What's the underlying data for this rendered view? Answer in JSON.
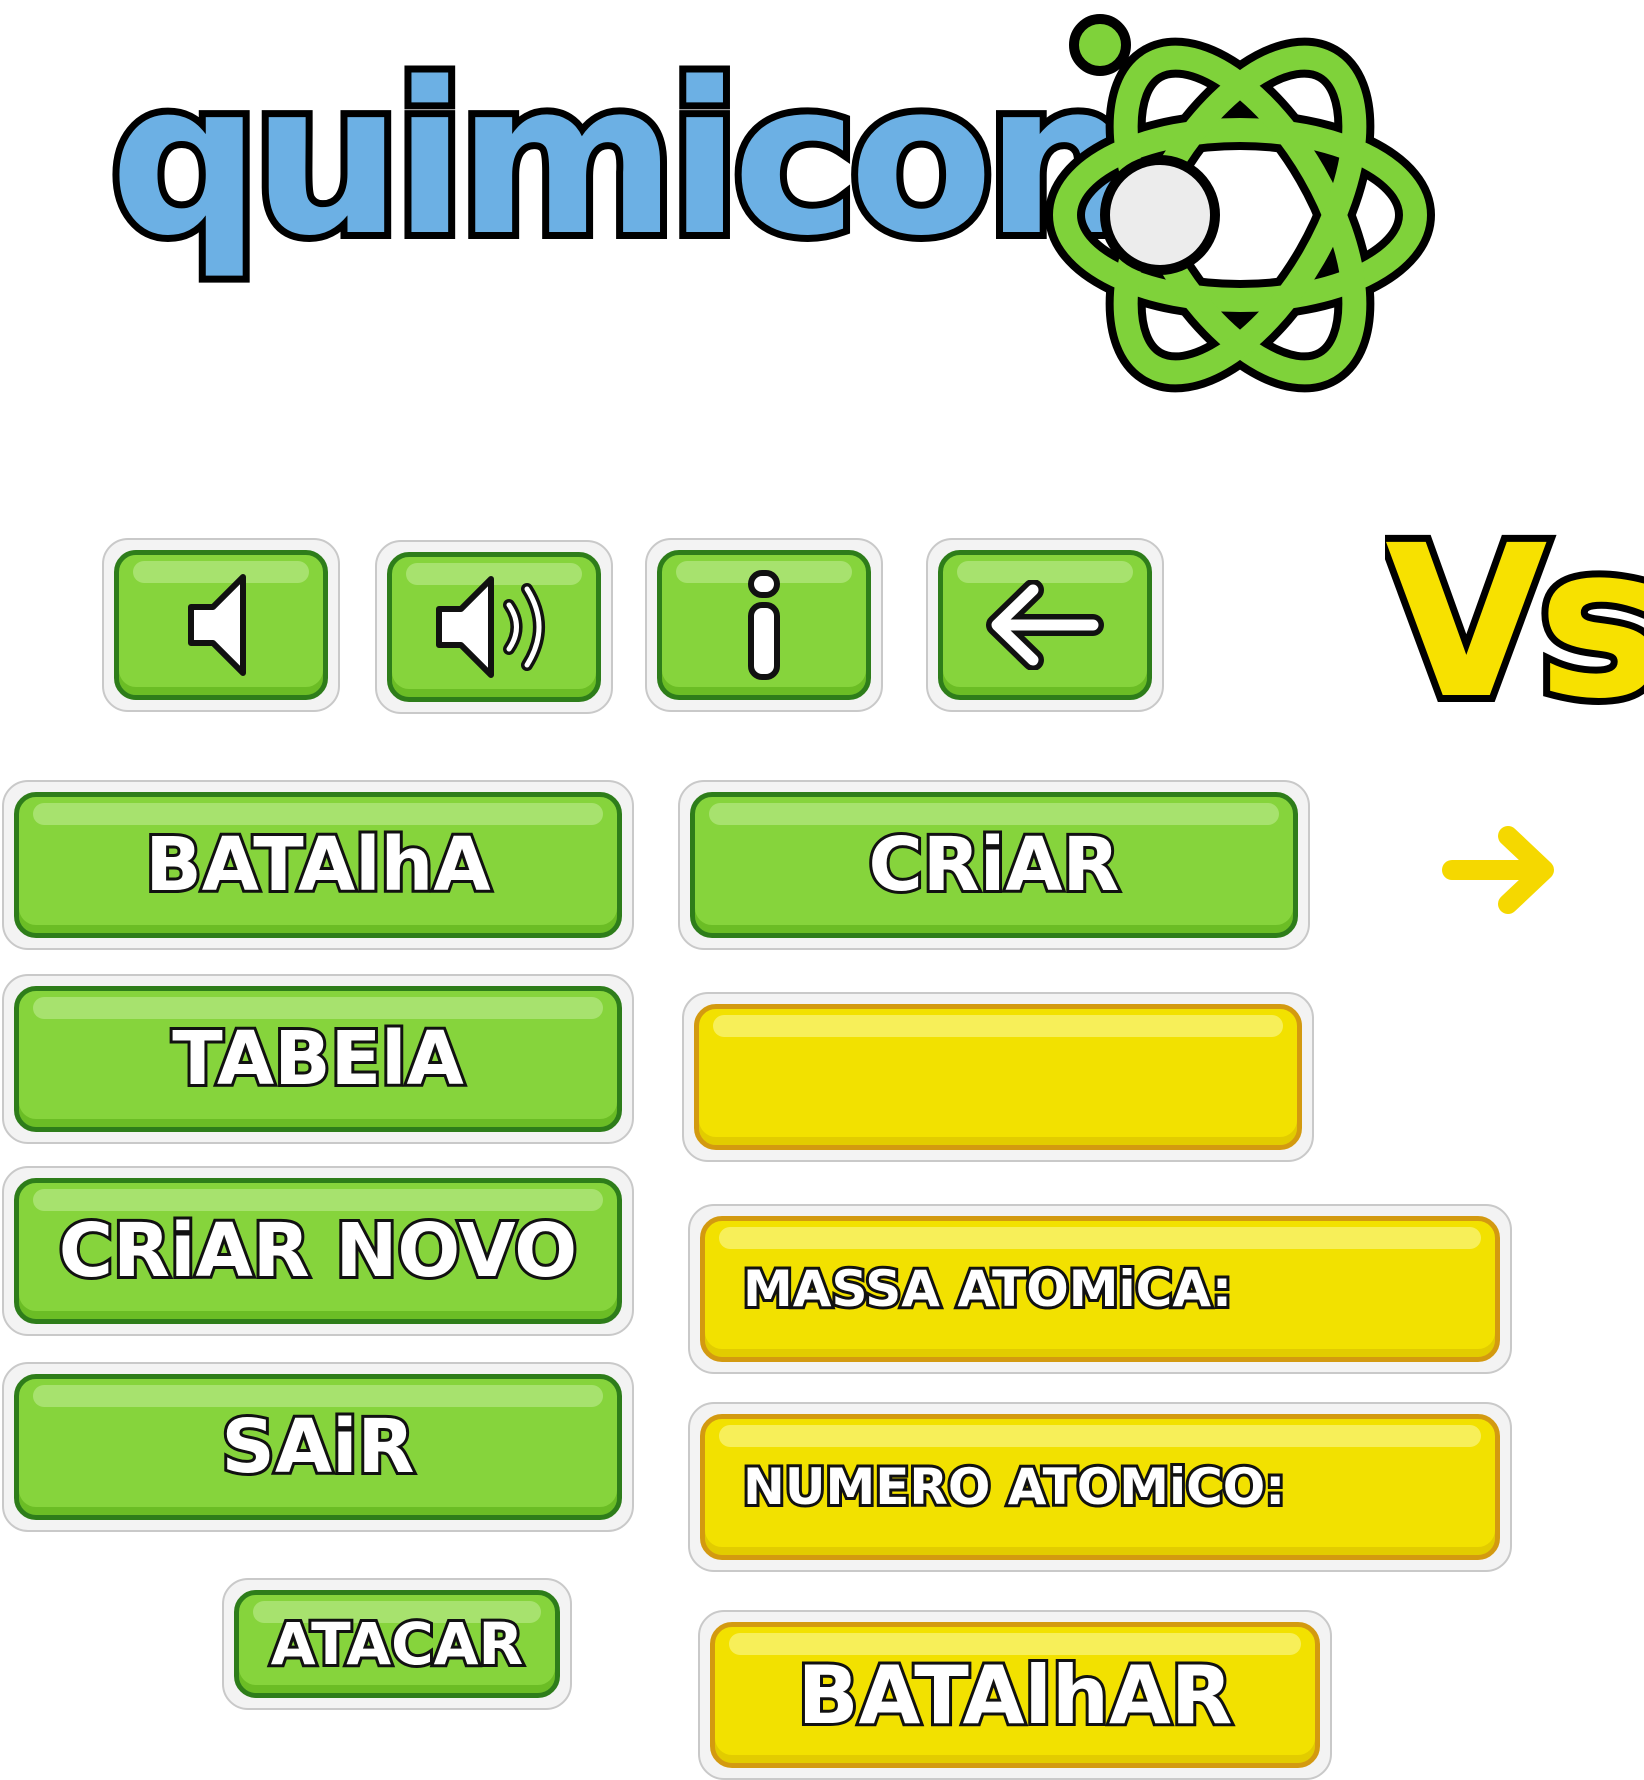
{
  "logo": {
    "text": "quimicon"
  },
  "vs": {
    "text": "Vs"
  },
  "icons": {
    "mute": "speaker-mute-icon",
    "sound": "speaker-sound-icon",
    "info": "info-icon",
    "back": "arrow-left-icon",
    "next": "arrow-right-icon"
  },
  "menu": {
    "batalha": "BATAlhA",
    "tabela": "TABElA",
    "criar_novo": "CRiAR NOVO",
    "sair": "SAiR",
    "atacar": "ATACAR",
    "criar": "CRiAR",
    "massa_atomica": "MASSA ATOMiCA:",
    "numero_atomico": "NUMERO ATOMiCO:",
    "batalhar": "BATAlhAR"
  },
  "colors": {
    "green": "#86d43c",
    "green_border": "#2e7d1a",
    "yellow": "#f2e100",
    "yellow_border": "#d39a10",
    "logo_blue": "#6cb0e4",
    "atom_green": "#7fd23a"
  }
}
